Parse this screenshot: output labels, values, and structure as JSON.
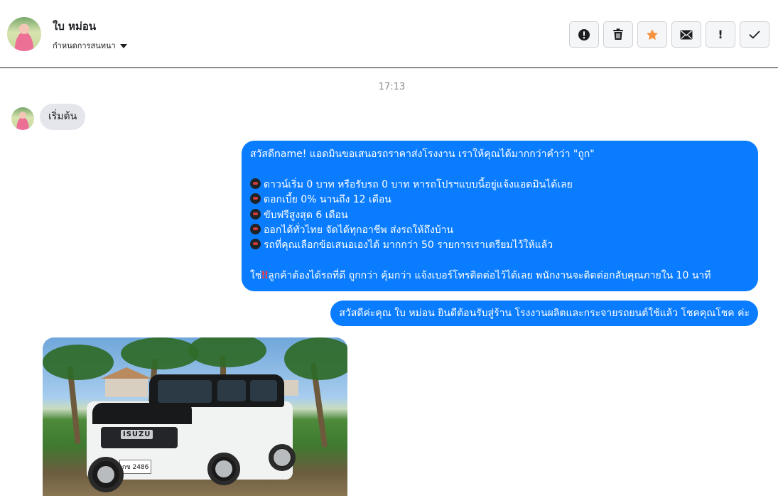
{
  "header": {
    "contact_name": "ใบ หม่อน",
    "assign_label": "กำหนดการสนทนา"
  },
  "toolbar": {
    "buttons": [
      {
        "icon": "alert-circle-icon"
      },
      {
        "icon": "trash-icon"
      },
      {
        "icon": "star-icon",
        "color": "#f5923e"
      },
      {
        "icon": "envelope-icon"
      },
      {
        "icon": "exclamation-icon",
        "label": "!"
      },
      {
        "icon": "check-icon"
      }
    ]
  },
  "conversation": {
    "timestamp": "17:13",
    "incoming": {
      "text": "เริ่มต้น"
    },
    "outgoing_main": {
      "greeting": "สวัสดีname! แอดมินขอเสนอรถราคาส่งโรงงาน เราให้คุณได้มากกว่าคำว่า \"ถูก\"",
      "bullets": [
        "ดาวน์เริ่ม 0 บาท หรือรับรถ 0 บาท หารถโปรฯแบบนี้อยู่แจ้งแอดมินได้เลย",
        "ดอกเบี้ย 0% นานถึง 12 เดือน",
        "ขับฟรีสูงสุด 6 เดือน",
        "ออกได้ทั่วไทย จัดได้ทุกอาชีพ ส่งรถให้ถึงบ้าน",
        "รถที่คุณเลือกข้อเสนอเองได้ มากกว่า 50 รายการเราเตรียมไว้ให้แล้ว"
      ],
      "closing_prefix": "ใช่",
      "closing_mark": "‼",
      "closing_text": "ลูกค้าต้องได้รถที่ดี ถูกกว่า คุ้มกว่า แจ้งเบอร์โทรติดต่อไว้ได้เลย พนักงานจะติดต่อกลับคุณภายใน 10 นาที"
    },
    "outgoing_second": {
      "text": "สวัสดีค่ะคุณ ใบ หม่อน ยินดีต้อนรับสู่ร้าน โรงงานผลิตและกระจายรถยนต์ใช้แล้ว โชคคุณโชค ค่ะ"
    },
    "photo": {
      "logo_text": "ISUZU",
      "plate_text": "กข 2486"
    }
  },
  "colors": {
    "outgoing_bubble": "#0a7cff",
    "incoming_bubble": "#e4e6eb",
    "star": "#f5923e"
  }
}
